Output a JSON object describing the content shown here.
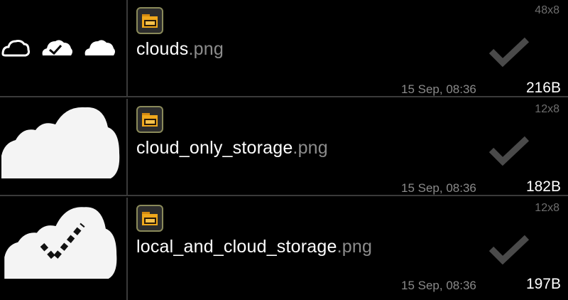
{
  "files": [
    {
      "name": "clouds",
      "ext": ".png",
      "dims": "48x8",
      "date": "15 Sep, 08:36",
      "size": "216B",
      "thumbnail": "clouds-sprite-icon",
      "file_icon": "folder-icon",
      "status_icon": "checkmark-icon"
    },
    {
      "name": "cloud_only_storage",
      "ext": ".png",
      "dims": "12x8",
      "date": "15 Sep, 08:36",
      "size": "182B",
      "thumbnail": "cloud-icon",
      "file_icon": "folder-icon",
      "status_icon": "checkmark-icon"
    },
    {
      "name": "local_and_cloud_storage",
      "ext": ".png",
      "dims": "12x8",
      "date": "15 Sep, 08:36",
      "size": "197B",
      "thumbnail": "cloud-check-icon",
      "file_icon": "folder-icon",
      "status_icon": "checkmark-icon"
    }
  ],
  "colors": {
    "background": "#000000",
    "divider": "#3a3a3a",
    "filename": "#ffffff",
    "extension": "#8c8c8c",
    "meta": "#8a8a8a",
    "checkmark": "#4a4a4a",
    "folder_accent": "#f0a81c"
  }
}
